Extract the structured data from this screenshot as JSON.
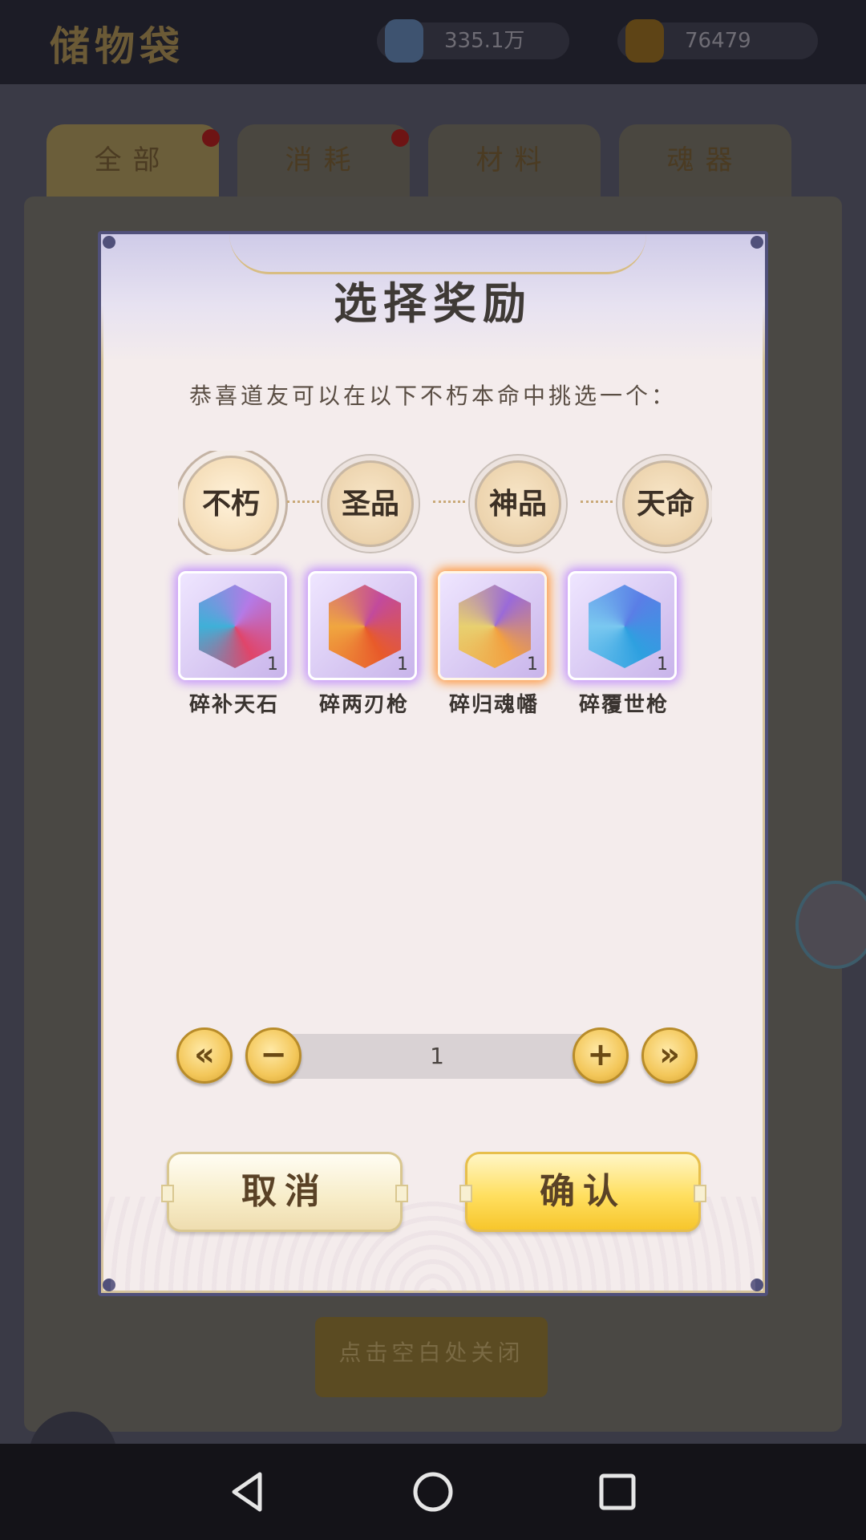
{
  "background": {
    "title": "储物袋",
    "resources": [
      {
        "icon": "spirit-crystal-icon",
        "value": "335.1万"
      },
      {
        "icon": "lightning-icon",
        "value": "76479"
      }
    ],
    "tabs": [
      {
        "label": "全部",
        "badge": true
      },
      {
        "label": "消耗",
        "badge": true
      },
      {
        "label": "材料",
        "badge": false
      },
      {
        "label": "魂器",
        "badge": false
      }
    ],
    "close_hint": "点击空白处关闭"
  },
  "modal": {
    "title": "选择奖励",
    "subtitle": "恭喜道友可以在以下不朽本命中挑选一个：",
    "grade_tabs": [
      {
        "label": "不朽",
        "active": true
      },
      {
        "label": "圣品",
        "active": false
      },
      {
        "label": "神品",
        "active": false
      },
      {
        "label": "天命",
        "active": false
      }
    ],
    "items": [
      {
        "name": "碎补天石",
        "count": "1",
        "selected": false,
        "colors": [
          "#b47ae6",
          "#e0456a",
          "#3fb0d8"
        ]
      },
      {
        "name": "碎两刃枪",
        "count": "1",
        "selected": false,
        "colors": [
          "#c24a9c",
          "#e85a2a",
          "#f0a640"
        ]
      },
      {
        "name": "碎归魂幡",
        "count": "1",
        "selected": true,
        "colors": [
          "#9a6ad8",
          "#f2a040",
          "#e8d070"
        ]
      },
      {
        "name": "碎覆世枪",
        "count": "1",
        "selected": false,
        "colors": [
          "#5a7ee6",
          "#2ea0e0",
          "#7ac8f0"
        ]
      }
    ],
    "stepper": {
      "value": "1",
      "min_label": "«",
      "decrement_label": "−",
      "increment_label": "+",
      "max_label": "»"
    },
    "cancel_label": "取消",
    "confirm_label": "确认"
  },
  "colors": {
    "modal_border": "#50507a",
    "gold_button": "#f7c62c",
    "selected_glow": "#ff8c28",
    "item_glow": "#b478ff"
  }
}
